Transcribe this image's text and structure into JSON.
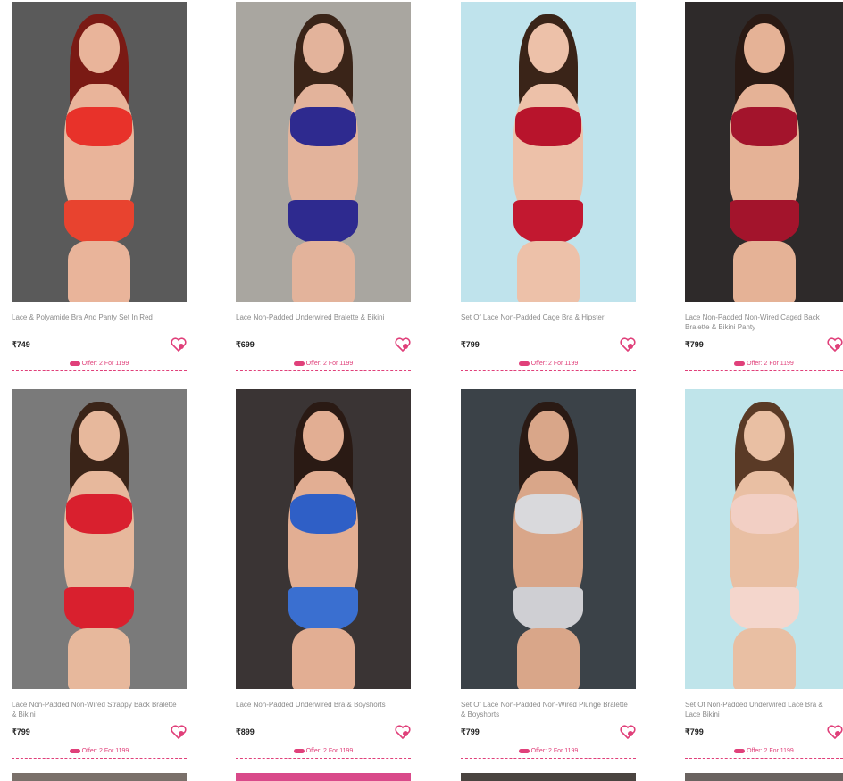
{
  "products": [
    {
      "title": "Lace & Polyamide Bra And Panty Set In Red",
      "price": "₹749",
      "offer": "Offer: 2 For 1199",
      "bg": "#5a5a5a",
      "top": "#e8322a",
      "bottom": "#e8432f",
      "hair": "#7a1a14",
      "skin": "#e9b49a"
    },
    {
      "title": "Lace Non-Padded Underwired Bralette & Bikini",
      "price": "₹699",
      "offer": "Offer: 2 For 1199",
      "bg": "#a9a6a0",
      "top": "#2e2a8f",
      "bottom": "#2e2a8f",
      "hair": "#3a2418",
      "skin": "#e3b39b"
    },
    {
      "title": "Set Of Lace Non-Padded Cage Bra & Hipster",
      "price": "₹799",
      "offer": "Offer: 2 For 1199",
      "bg": "#bfe3ec",
      "top": "#b8142c",
      "bottom": "#c21830",
      "hair": "#3a2418",
      "skin": "#edc1a9"
    },
    {
      "title": "Lace Non-Padded Non-Wired Caged Back Bralette & Bikini Panty",
      "price": "₹799",
      "offer": "Offer: 2 For 1199",
      "bg": "#2e2a2a",
      "top": "#a3142c",
      "bottom": "#a3142c",
      "hair": "#2a1a14",
      "skin": "#e5b296"
    },
    {
      "title": "Lace Non-Padded Non-Wired Strappy Back Bralette & Bikini",
      "price": "₹799",
      "offer": "Offer: 2 For 1199",
      "bg": "#7a7a7a",
      "top": "#d9202e",
      "bottom": "#d9202e",
      "hair": "#3a2418",
      "skin": "#e7b89c"
    },
    {
      "title": "Lace Non-Padded Underwired Bra & Boyshorts",
      "price": "₹899",
      "offer": "Offer: 2 For 1199",
      "bg": "#3a3434",
      "top": "#2f5fc6",
      "bottom": "#3a6fd0",
      "hair": "#2a1a14",
      "skin": "#e2ae93"
    },
    {
      "title": "Set Of Lace Non-Padded Non-Wired Plunge Bralette & Boyshorts",
      "price": "₹799",
      "offer": "Offer: 2 For 1199",
      "bg": "#3b4248",
      "top": "#d9d9dc",
      "bottom": "#cfcfd3",
      "hair": "#2a1a14",
      "skin": "#d9a689"
    },
    {
      "title": "Set Of Non-Padded Underwired Lace Bra & Lace Bikini",
      "price": "₹799",
      "offer": "Offer: 2 For 1199",
      "bg": "#bfe4ea",
      "top": "#f2cfc4",
      "bottom": "#f4d6cc",
      "hair": "#5a3a26",
      "skin": "#e9bfa3"
    }
  ],
  "accent": "#e0407a"
}
